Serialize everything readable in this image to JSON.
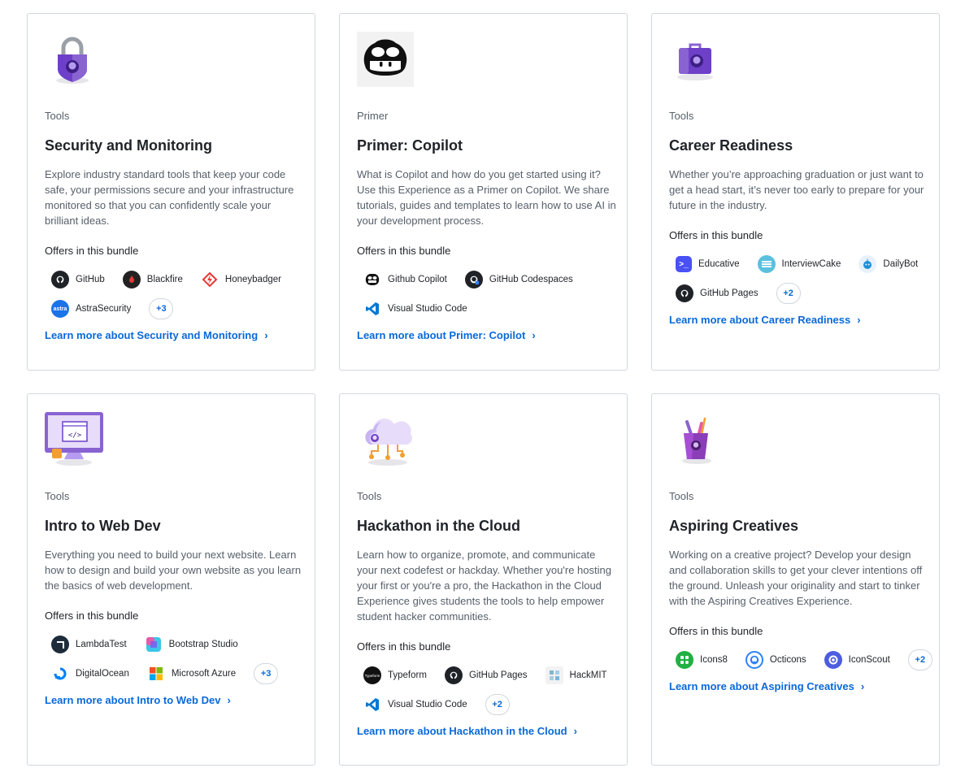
{
  "cards": [
    {
      "category": "Tools",
      "title": "Security and Monitoring",
      "description": "Explore industry standard tools that keep your code safe, your permissions secure and your infrastructure monitored so that you can confidently scale your brilliant ideas.",
      "offers_label": "Offers in this bundle",
      "offers": [
        "GitHub",
        "Blackfire",
        "Honeybadger",
        "AstraSecurity"
      ],
      "more": "+3",
      "link": "Learn more about Security and Monitoring",
      "illustration": "padlock-github-icon"
    },
    {
      "category": "Primer",
      "title": "Primer: Copilot",
      "description": "What is Copilot and how do you get started using it? Use this Experience as a Primer on Copilot. We share tutorials, guides and templates to learn how to use AI in your development process.",
      "offers_label": "Offers in this bundle",
      "offers": [
        "Github Copilot",
        "GitHub Codespaces",
        "Visual Studio Code"
      ],
      "more": "",
      "link": "Learn more about Primer: Copilot",
      "illustration": "copilot-icon"
    },
    {
      "category": "Tools",
      "title": "Career Readiness",
      "description": "Whether you’re approaching graduation or just want to get a head start, it’s never too early to prepare for your future in the industry.",
      "offers_label": "Offers in this bundle",
      "offers": [
        "Educative",
        "InterviewCake",
        "DailyBot",
        "GitHub Pages"
      ],
      "more": "+2",
      "link": "Learn more about Career Readiness",
      "illustration": "briefcase-icon"
    },
    {
      "category": "Tools",
      "title": "Intro to Web Dev",
      "description": "Everything you need to build your next website. Learn how to design and build your own website as you learn the basics of web development.",
      "offers_label": "Offers in this bundle",
      "offers": [
        "LambdaTest",
        "Bootstrap Studio",
        "DigitalOcean",
        "Microsoft Azure"
      ],
      "more": "+3",
      "link": "Learn more about Intro to Web Dev",
      "illustration": "monitor-code-icon"
    },
    {
      "category": "Tools",
      "title": "Hackathon in the Cloud",
      "description": "Learn how to organize, promote, and communicate your next codefest or hackday. Whether you're hosting your first or you're a pro, the Hackathon in the Cloud Experience gives students the tools to help empower student hacker communities.",
      "offers_label": "Offers in this bundle",
      "offers": [
        "Typeform",
        "GitHub Pages",
        "HackMIT",
        "Visual Studio Code"
      ],
      "more": "+2",
      "link": "Learn more about Hackathon in the Cloud",
      "illustration": "cloud-icon"
    },
    {
      "category": "Tools",
      "title": "Aspiring Creatives",
      "description": "Working on a creative project? Develop your design and collaboration skills to get your clever intentions off the ground. Unleash your originality and start to tinker with the Aspiring Creatives Experience.",
      "offers_label": "Offers in this bundle",
      "offers": [
        "Icons8",
        "Octicons",
        "IconScout"
      ],
      "more": "+2",
      "link": "Learn more about Aspiring Creatives",
      "illustration": "pencil-cup-icon"
    }
  ],
  "colors": {
    "link": "#0969da",
    "border": "#d0d7de",
    "muted": "#57606a",
    "purple": "#6e40c9"
  }
}
